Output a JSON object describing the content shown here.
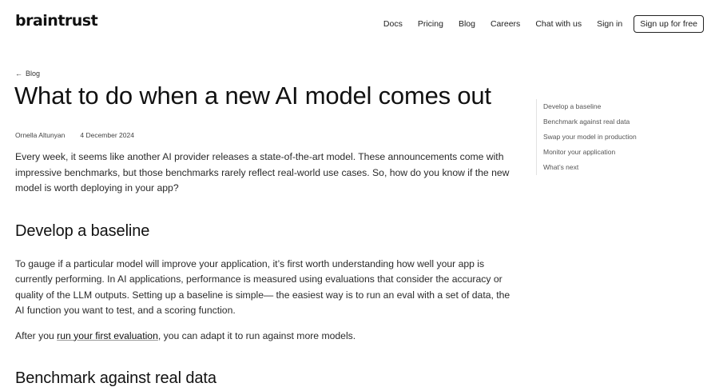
{
  "header": {
    "logo": "braintrust",
    "nav": [
      "Docs",
      "Pricing",
      "Blog",
      "Careers",
      "Chat with us",
      "Sign in"
    ],
    "signup_label": "Sign up for free"
  },
  "article": {
    "back_label": "Blog",
    "title": "What to do when a new AI model comes out",
    "author": "Ornella Altunyan",
    "date": "4 December 2024",
    "intro": "Every week, it seems like another AI provider releases a state-of-the-art model. These announcements come with impressive benchmarks, but those benchmarks rarely reflect real-world use cases. So, how do you know if the new model is worth deploying in your app?",
    "section1_heading": "Develop a baseline",
    "section1_para": "To gauge if a particular model will improve your application, it’s first worth understanding how well your app is currently performing. In AI applications, performance is measured using evaluations that consider the accuracy or quality of the LLM outputs. Setting up a baseline is simple— the easiest way is to run an eval with a set of data, the AI function you want to test, and a scoring function.",
    "section1_para2_prefix": "After you ",
    "section1_para2_link": "run your first evaluation",
    "section1_para2_suffix": ", you can adapt it to run against more models.",
    "section2_heading": "Benchmark against real data"
  },
  "toc": {
    "items": [
      "Develop a baseline",
      "Benchmark against real data",
      "Swap your model in production",
      "Monitor your application",
      "What’s next"
    ]
  }
}
